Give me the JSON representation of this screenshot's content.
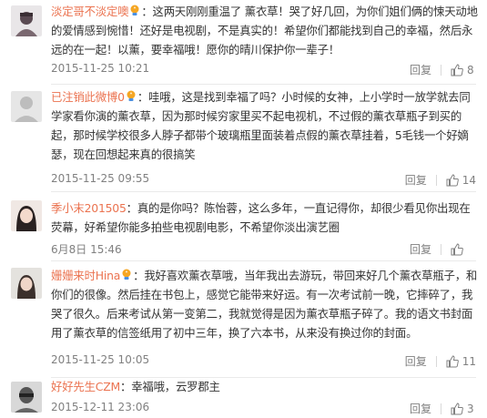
{
  "comments": [
    {
      "username": "淡定哥不淡定噢",
      "text": "：这两天刚刚重温了 薰衣草！哭了好几回，为你们姐们俩的悚天动地的爱情感到惋惜！还好是电视剧，不是真实的！希望你们都能找到自己的幸福，然后永远的在一起！以薰，要幸福哦！愿你的晴川保护你一辈子！",
      "date": "2015-11-25 10:21",
      "reply": "回复",
      "likes": "8"
    },
    {
      "username": "已注销此微博0",
      "text": "：哇哦，这是找到幸福了吗？小时候的女神，上小学时一放学就去同学家看你演的薰衣草，因为那时候穷家里买不起电视机，不过假的薰衣草瓶子到买的起，那时候学校很多人脖子都带个玻璃瓶里面装着点假的薰衣草挂着，5毛钱一个好嫡瑟，现在回想起来真的很搞笑",
      "date": "2015-11-25 09:55",
      "reply": "回复",
      "likes": "14"
    },
    {
      "username": "季小末201505",
      "text": "：真的是你吗？陈怡蓉，这么多年，一直记得你，却很少看见你出现在荧幕，好希望你能多拍些电视剧电影，不希望你淡出演艺圈",
      "date": "6月8日 15:46",
      "reply": "回复",
      "likes": ""
    },
    {
      "username": "姗姗来时Hina",
      "text": "：我好喜欢薰衣草哦，当年我出去游玩，带回来好几个薰衣草瓶子，和你们的很像。然后挂在书包上，感觉它能带来好运。有一次考试前一晚，它摔碎了，我哭了很久。后来考试从第一变第二，我就觉得是因为薰衣草瓶子碎了。我的语文书封面用了薰衣草的信签纸用了初中三年，换了六本书，从来没有换过你的封面。",
      "date": "2015-11-25 10:05",
      "reply": "回复",
      "likes": "11"
    },
    {
      "username": "好好先生CZM",
      "text": "：幸福哦，云罗郡主",
      "date": "2015-12-11 23:06",
      "reply": "回复",
      "likes": "3"
    }
  ],
  "colors": {
    "username": "#eb7350",
    "text": "#333333",
    "meta": "#808080",
    "divider": "#eaeaea"
  },
  "icons": {
    "badge": "lightbulb-badge-icon",
    "like": "thumbs-up-icon"
  }
}
